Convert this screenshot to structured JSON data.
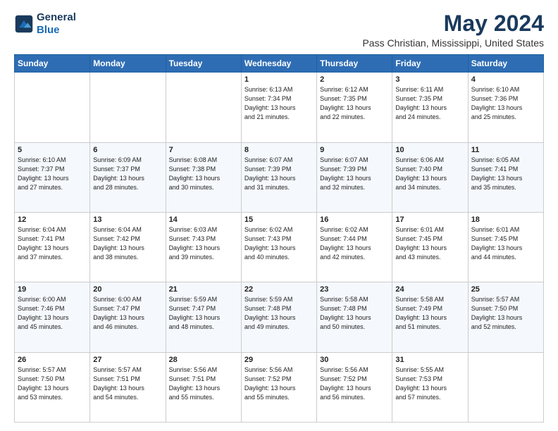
{
  "logo": {
    "line1": "General",
    "line2": "Blue"
  },
  "header": {
    "month": "May 2024",
    "location": "Pass Christian, Mississippi, United States"
  },
  "days_of_week": [
    "Sunday",
    "Monday",
    "Tuesday",
    "Wednesday",
    "Thursday",
    "Friday",
    "Saturday"
  ],
  "weeks": [
    [
      {
        "day": "",
        "info": ""
      },
      {
        "day": "",
        "info": ""
      },
      {
        "day": "",
        "info": ""
      },
      {
        "day": "1",
        "info": "Sunrise: 6:13 AM\nSunset: 7:34 PM\nDaylight: 13 hours\nand 21 minutes."
      },
      {
        "day": "2",
        "info": "Sunrise: 6:12 AM\nSunset: 7:35 PM\nDaylight: 13 hours\nand 22 minutes."
      },
      {
        "day": "3",
        "info": "Sunrise: 6:11 AM\nSunset: 7:35 PM\nDaylight: 13 hours\nand 24 minutes."
      },
      {
        "day": "4",
        "info": "Sunrise: 6:10 AM\nSunset: 7:36 PM\nDaylight: 13 hours\nand 25 minutes."
      }
    ],
    [
      {
        "day": "5",
        "info": "Sunrise: 6:10 AM\nSunset: 7:37 PM\nDaylight: 13 hours\nand 27 minutes."
      },
      {
        "day": "6",
        "info": "Sunrise: 6:09 AM\nSunset: 7:37 PM\nDaylight: 13 hours\nand 28 minutes."
      },
      {
        "day": "7",
        "info": "Sunrise: 6:08 AM\nSunset: 7:38 PM\nDaylight: 13 hours\nand 30 minutes."
      },
      {
        "day": "8",
        "info": "Sunrise: 6:07 AM\nSunset: 7:39 PM\nDaylight: 13 hours\nand 31 minutes."
      },
      {
        "day": "9",
        "info": "Sunrise: 6:07 AM\nSunset: 7:39 PM\nDaylight: 13 hours\nand 32 minutes."
      },
      {
        "day": "10",
        "info": "Sunrise: 6:06 AM\nSunset: 7:40 PM\nDaylight: 13 hours\nand 34 minutes."
      },
      {
        "day": "11",
        "info": "Sunrise: 6:05 AM\nSunset: 7:41 PM\nDaylight: 13 hours\nand 35 minutes."
      }
    ],
    [
      {
        "day": "12",
        "info": "Sunrise: 6:04 AM\nSunset: 7:41 PM\nDaylight: 13 hours\nand 37 minutes."
      },
      {
        "day": "13",
        "info": "Sunrise: 6:04 AM\nSunset: 7:42 PM\nDaylight: 13 hours\nand 38 minutes."
      },
      {
        "day": "14",
        "info": "Sunrise: 6:03 AM\nSunset: 7:43 PM\nDaylight: 13 hours\nand 39 minutes."
      },
      {
        "day": "15",
        "info": "Sunrise: 6:02 AM\nSunset: 7:43 PM\nDaylight: 13 hours\nand 40 minutes."
      },
      {
        "day": "16",
        "info": "Sunrise: 6:02 AM\nSunset: 7:44 PM\nDaylight: 13 hours\nand 42 minutes."
      },
      {
        "day": "17",
        "info": "Sunrise: 6:01 AM\nSunset: 7:45 PM\nDaylight: 13 hours\nand 43 minutes."
      },
      {
        "day": "18",
        "info": "Sunrise: 6:01 AM\nSunset: 7:45 PM\nDaylight: 13 hours\nand 44 minutes."
      }
    ],
    [
      {
        "day": "19",
        "info": "Sunrise: 6:00 AM\nSunset: 7:46 PM\nDaylight: 13 hours\nand 45 minutes."
      },
      {
        "day": "20",
        "info": "Sunrise: 6:00 AM\nSunset: 7:47 PM\nDaylight: 13 hours\nand 46 minutes."
      },
      {
        "day": "21",
        "info": "Sunrise: 5:59 AM\nSunset: 7:47 PM\nDaylight: 13 hours\nand 48 minutes."
      },
      {
        "day": "22",
        "info": "Sunrise: 5:59 AM\nSunset: 7:48 PM\nDaylight: 13 hours\nand 49 minutes."
      },
      {
        "day": "23",
        "info": "Sunrise: 5:58 AM\nSunset: 7:48 PM\nDaylight: 13 hours\nand 50 minutes."
      },
      {
        "day": "24",
        "info": "Sunrise: 5:58 AM\nSunset: 7:49 PM\nDaylight: 13 hours\nand 51 minutes."
      },
      {
        "day": "25",
        "info": "Sunrise: 5:57 AM\nSunset: 7:50 PM\nDaylight: 13 hours\nand 52 minutes."
      }
    ],
    [
      {
        "day": "26",
        "info": "Sunrise: 5:57 AM\nSunset: 7:50 PM\nDaylight: 13 hours\nand 53 minutes."
      },
      {
        "day": "27",
        "info": "Sunrise: 5:57 AM\nSunset: 7:51 PM\nDaylight: 13 hours\nand 54 minutes."
      },
      {
        "day": "28",
        "info": "Sunrise: 5:56 AM\nSunset: 7:51 PM\nDaylight: 13 hours\nand 55 minutes."
      },
      {
        "day": "29",
        "info": "Sunrise: 5:56 AM\nSunset: 7:52 PM\nDaylight: 13 hours\nand 55 minutes."
      },
      {
        "day": "30",
        "info": "Sunrise: 5:56 AM\nSunset: 7:52 PM\nDaylight: 13 hours\nand 56 minutes."
      },
      {
        "day": "31",
        "info": "Sunrise: 5:55 AM\nSunset: 7:53 PM\nDaylight: 13 hours\nand 57 minutes."
      },
      {
        "day": "",
        "info": ""
      }
    ]
  ]
}
